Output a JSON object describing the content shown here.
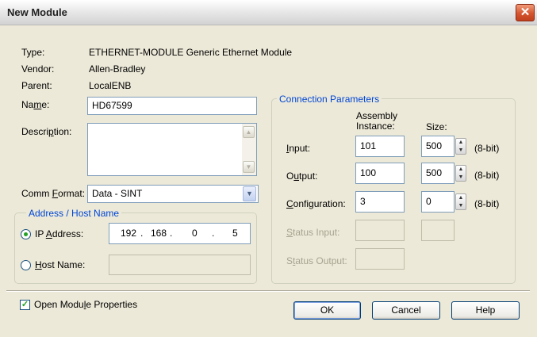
{
  "window": {
    "title": "New Module",
    "close_glyph": "✕"
  },
  "info": {
    "type_label": "Type:",
    "type_value": "ETHERNET-MODULE Generic Ethernet Module",
    "vendor_label": "Vendor:",
    "vendor_value": "Allen-Bradley",
    "parent_label": "Parent:",
    "parent_value": "LocalENB"
  },
  "name": {
    "pre": "Na",
    "key": "m",
    "post": "e:",
    "value": "HD67599"
  },
  "description": {
    "pre": "Descri",
    "key": "p",
    "post": "tion:",
    "value": ""
  },
  "comm_format": {
    "pre": "Comm ",
    "key": "F",
    "post": "ormat:",
    "value": "Data - SINT"
  },
  "address": {
    "legend": "Address / Host Name",
    "ip_pre": "IP ",
    "ip_key": "A",
    "ip_post": "ddress:",
    "ip_octets": [
      "192",
      "168",
      "0",
      "5"
    ],
    "ip_dot": ".",
    "host_pre": "",
    "host_key": "H",
    "host_post": "ost Name:",
    "host_value": "",
    "selected": "ip"
  },
  "connection": {
    "legend": "Connection Parameters",
    "col_assembly": "Assembly\nInstance:",
    "col_size": "Size:",
    "unit": "(8-bit)",
    "rows": [
      {
        "pre": "",
        "key": "I",
        "post": "nput:",
        "instance": "101",
        "size": "500",
        "enabled": true
      },
      {
        "pre": "O",
        "key": "u",
        "post": "tput:",
        "instance": "100",
        "size": "500",
        "enabled": true
      },
      {
        "pre": "",
        "key": "C",
        "post": "onfiguration:",
        "instance": "3",
        "size": "0",
        "enabled": true
      },
      {
        "pre": "",
        "key": "S",
        "post": "tatus Input:",
        "instance": "",
        "size": "",
        "enabled": false
      },
      {
        "pre": "S",
        "key": "t",
        "post": "atus Output:",
        "instance": "",
        "size": "",
        "enabled": false
      }
    ]
  },
  "open_props": {
    "pre": "Open Modu",
    "key": "l",
    "post": "e Properties",
    "checked": true
  },
  "buttons": {
    "ok": "OK",
    "cancel": "Cancel",
    "help": "Help"
  },
  "icons": {
    "up": "▲",
    "down": "▼",
    "check": "✓"
  }
}
